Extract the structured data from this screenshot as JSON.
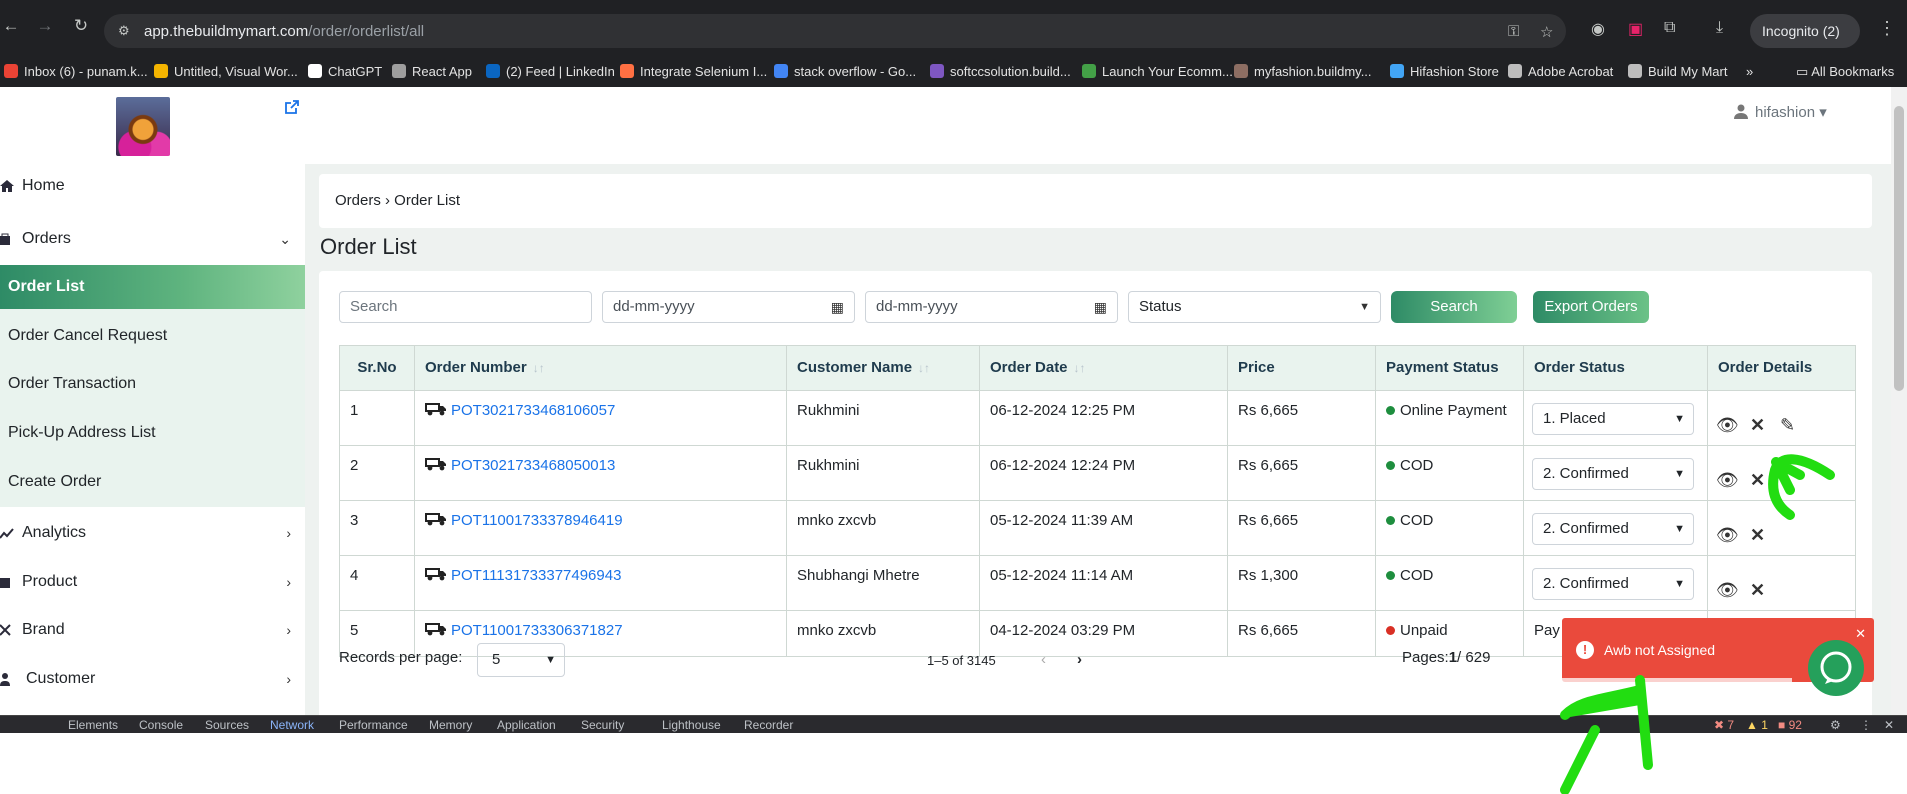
{
  "browser": {
    "url_host": "app.thebuildmymart.com",
    "url_path": "/order/orderlist/all",
    "incognito_label": "Incognito (2)",
    "all_bookmarks": "All Bookmarks",
    "bookmarks": [
      {
        "label": "Inbox (6) - punam.k...",
        "color": "#ea4335"
      },
      {
        "label": "Untitled, Visual Wor...",
        "color": "#f4b400"
      },
      {
        "label": "ChatGPT",
        "color": "#ffffff"
      },
      {
        "label": "React App",
        "color": "#9e9e9e"
      },
      {
        "label": "(2) Feed | LinkedIn",
        "color": "#0a66c2"
      },
      {
        "label": "Integrate Selenium I...",
        "color": "#ff7043"
      },
      {
        "label": "stack overflow - Go...",
        "color": "#4285f4"
      },
      {
        "label": "softccsolution.build...",
        "color": "#7e57c2"
      },
      {
        "label": "Launch Your Ecomm...",
        "color": "#43a047"
      },
      {
        "label": "myfashion.buildmy...",
        "color": "#8d6e63"
      },
      {
        "label": "Hifashion Store",
        "color": "#42a5f5"
      },
      {
        "label": "Adobe Acrobat",
        "color": "#bdbdbd"
      },
      {
        "label": "Build My Mart",
        "color": "#bdbdbd"
      }
    ]
  },
  "header": {
    "user": "hifashion"
  },
  "sidebar": {
    "home": "Home",
    "orders": "Orders",
    "sub_items": [
      "Order List",
      "Order Cancel Request",
      "Order Transaction",
      "Pick-Up Address List",
      "Create Order"
    ],
    "analytics": "Analytics",
    "product": "Product",
    "brand": "Brand",
    "customer": "Customer"
  },
  "main": {
    "breadcrumb": "Orders › Order List",
    "title": "Order List",
    "filters": {
      "search_placeholder": "Search",
      "date_from": "dd-mm-yyyy",
      "date_to": "dd-mm-yyyy",
      "status": "Status",
      "search_button": "Search",
      "export_button": "Export Orders"
    },
    "columns": [
      "Sr.No",
      "Order Number",
      "Customer Name",
      "Order Date",
      "Price",
      "Payment Status",
      "Order Status",
      "Order Details"
    ],
    "rows": [
      {
        "sr": "1",
        "order": "POT3021733468106057",
        "customer": "Rukhmini",
        "date": "06-12-2024 12:25 PM",
        "price": "Rs 6,665",
        "payment": "Online Payment",
        "pay_color": "#1e8e3e",
        "status": "1. Placed"
      },
      {
        "sr": "2",
        "order": "POT3021733468050013",
        "customer": "Rukhmini",
        "date": "06-12-2024 12:24 PM",
        "price": "Rs 6,665",
        "payment": "COD",
        "pay_color": "#1e8e3e",
        "status": "2. Confirmed"
      },
      {
        "sr": "3",
        "order": "POT11001733378946419",
        "customer": "mnko zxcvb",
        "date": "05-12-2024 11:39 AM",
        "price": "Rs 6,665",
        "payment": "COD",
        "pay_color": "#1e8e3e",
        "status": "2. Confirmed"
      },
      {
        "sr": "4",
        "order": "POT11131733377496943",
        "customer": "Shubhangi Mhetre",
        "date": "05-12-2024 11:14 AM",
        "price": "Rs 1,300",
        "payment": "COD",
        "pay_color": "#1e8e3e",
        "status": "2. Confirmed"
      },
      {
        "sr": "5",
        "order": "POT11001733306371827",
        "customer": "mnko zxcvb",
        "date": "04-12-2024 03:29 PM",
        "price": "Rs 6,665",
        "payment": "Unpaid",
        "pay_color": "#d93025",
        "status": "Pay"
      }
    ],
    "pagination": {
      "records_label": "Records per page:",
      "records_value": "5",
      "range": "1–5 of 3145",
      "pages_label": "Pages:",
      "page_current": "1",
      "page_total": "/ 629"
    }
  },
  "toast": {
    "message": "Awb not Assigned"
  },
  "devtools": {
    "tabs": [
      "Elements",
      "Console",
      "Sources",
      "Network",
      "Performance",
      "Memory",
      "Application",
      "Security",
      "Lighthouse",
      "Recorder"
    ],
    "active_tab": "Network",
    "errors": "7",
    "warnings": "1",
    "issues": "92"
  },
  "colors": {
    "accent": "#2e8b66",
    "annotation": "#22dd11"
  }
}
